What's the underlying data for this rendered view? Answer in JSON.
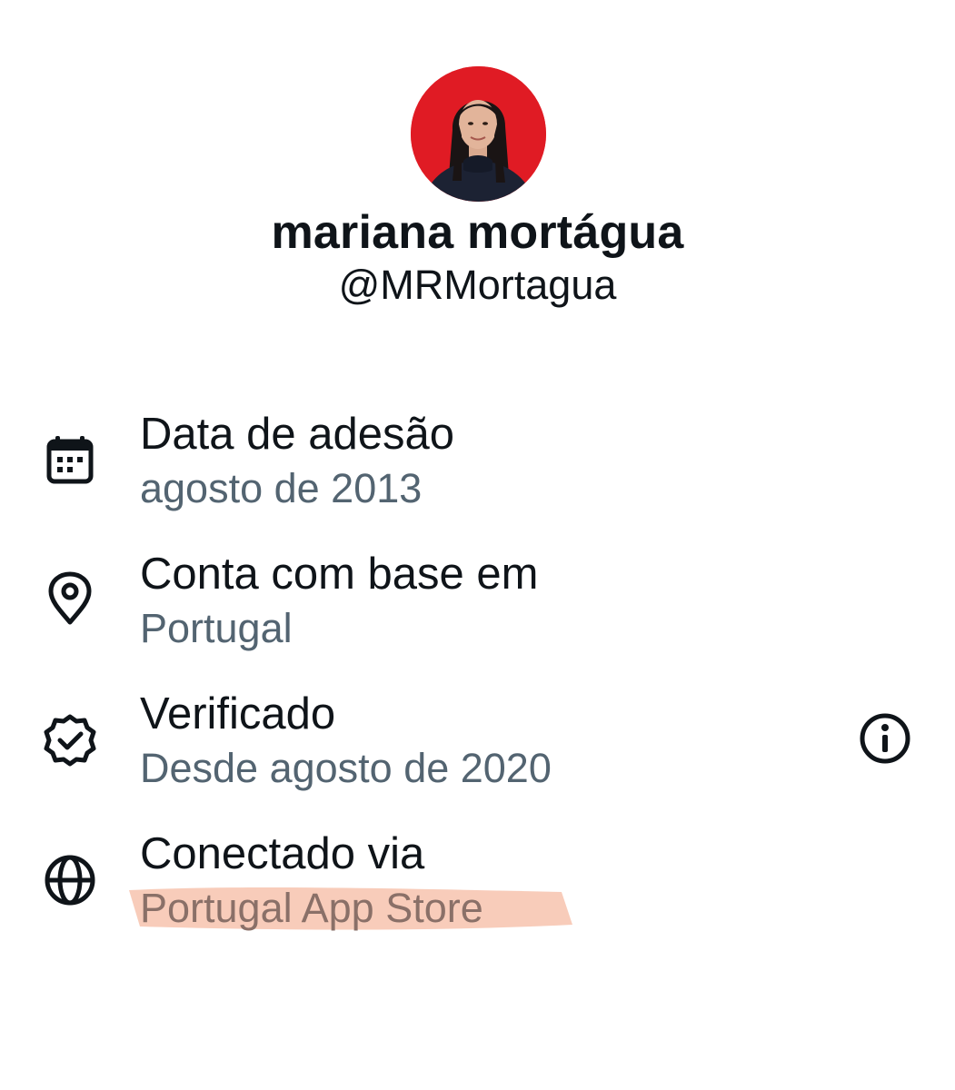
{
  "profile": {
    "display_name": "mariana mortágua",
    "handle": "@MRMortagua",
    "avatar_bg": "#e01b24"
  },
  "about": {
    "items": [
      {
        "icon": "calendar-icon",
        "title": "Data de adesão",
        "subtitle": "agosto de 2013"
      },
      {
        "icon": "location-pin-icon",
        "title": "Conta com base em",
        "subtitle": "Portugal"
      },
      {
        "icon": "verified-badge-icon",
        "title": "Verificado",
        "subtitle": "Desde agosto de 2020",
        "action_icon": "info-icon"
      },
      {
        "icon": "globe-icon",
        "title": "Conectado via",
        "subtitle": "Portugal App Store",
        "highlight_color": "#f7c6b3"
      }
    ]
  },
  "colors": {
    "text_primary": "#0f1419",
    "text_secondary": "#536471",
    "icon": "#0f1419"
  }
}
